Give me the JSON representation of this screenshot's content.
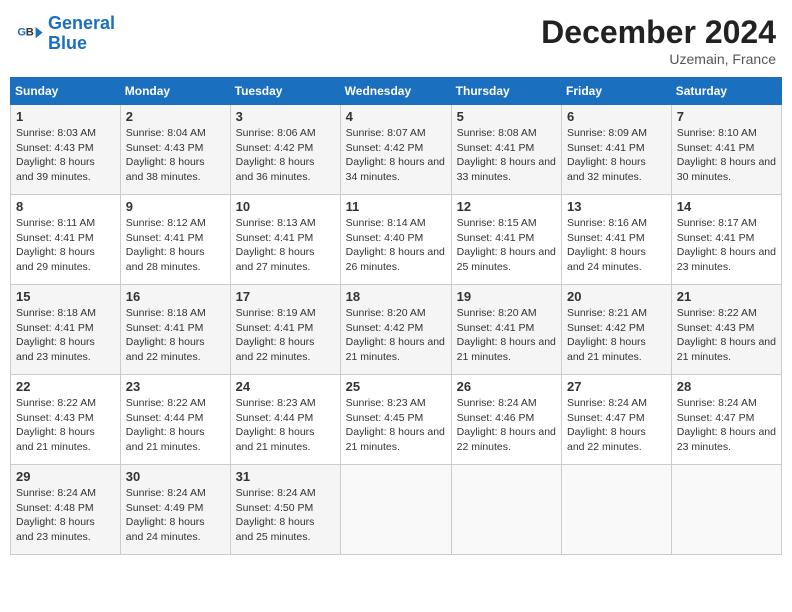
{
  "header": {
    "logo_line1": "General",
    "logo_line2": "Blue",
    "month_title": "December 2024",
    "location": "Uzemain, France"
  },
  "weekdays": [
    "Sunday",
    "Monday",
    "Tuesday",
    "Wednesday",
    "Thursday",
    "Friday",
    "Saturday"
  ],
  "weeks": [
    [
      {
        "day": "1",
        "sunrise": "Sunrise: 8:03 AM",
        "sunset": "Sunset: 4:43 PM",
        "daylight": "Daylight: 8 hours and 39 minutes."
      },
      {
        "day": "2",
        "sunrise": "Sunrise: 8:04 AM",
        "sunset": "Sunset: 4:43 PM",
        "daylight": "Daylight: 8 hours and 38 minutes."
      },
      {
        "day": "3",
        "sunrise": "Sunrise: 8:06 AM",
        "sunset": "Sunset: 4:42 PM",
        "daylight": "Daylight: 8 hours and 36 minutes."
      },
      {
        "day": "4",
        "sunrise": "Sunrise: 8:07 AM",
        "sunset": "Sunset: 4:42 PM",
        "daylight": "Daylight: 8 hours and 34 minutes."
      },
      {
        "day": "5",
        "sunrise": "Sunrise: 8:08 AM",
        "sunset": "Sunset: 4:41 PM",
        "daylight": "Daylight: 8 hours and 33 minutes."
      },
      {
        "day": "6",
        "sunrise": "Sunrise: 8:09 AM",
        "sunset": "Sunset: 4:41 PM",
        "daylight": "Daylight: 8 hours and 32 minutes."
      },
      {
        "day": "7",
        "sunrise": "Sunrise: 8:10 AM",
        "sunset": "Sunset: 4:41 PM",
        "daylight": "Daylight: 8 hours and 30 minutes."
      }
    ],
    [
      {
        "day": "8",
        "sunrise": "Sunrise: 8:11 AM",
        "sunset": "Sunset: 4:41 PM",
        "daylight": "Daylight: 8 hours and 29 minutes."
      },
      {
        "day": "9",
        "sunrise": "Sunrise: 8:12 AM",
        "sunset": "Sunset: 4:41 PM",
        "daylight": "Daylight: 8 hours and 28 minutes."
      },
      {
        "day": "10",
        "sunrise": "Sunrise: 8:13 AM",
        "sunset": "Sunset: 4:41 PM",
        "daylight": "Daylight: 8 hours and 27 minutes."
      },
      {
        "day": "11",
        "sunrise": "Sunrise: 8:14 AM",
        "sunset": "Sunset: 4:40 PM",
        "daylight": "Daylight: 8 hours and 26 minutes."
      },
      {
        "day": "12",
        "sunrise": "Sunrise: 8:15 AM",
        "sunset": "Sunset: 4:41 PM",
        "daylight": "Daylight: 8 hours and 25 minutes."
      },
      {
        "day": "13",
        "sunrise": "Sunrise: 8:16 AM",
        "sunset": "Sunset: 4:41 PM",
        "daylight": "Daylight: 8 hours and 24 minutes."
      },
      {
        "day": "14",
        "sunrise": "Sunrise: 8:17 AM",
        "sunset": "Sunset: 4:41 PM",
        "daylight": "Daylight: 8 hours and 23 minutes."
      }
    ],
    [
      {
        "day": "15",
        "sunrise": "Sunrise: 8:18 AM",
        "sunset": "Sunset: 4:41 PM",
        "daylight": "Daylight: 8 hours and 23 minutes."
      },
      {
        "day": "16",
        "sunrise": "Sunrise: 8:18 AM",
        "sunset": "Sunset: 4:41 PM",
        "daylight": "Daylight: 8 hours and 22 minutes."
      },
      {
        "day": "17",
        "sunrise": "Sunrise: 8:19 AM",
        "sunset": "Sunset: 4:41 PM",
        "daylight": "Daylight: 8 hours and 22 minutes."
      },
      {
        "day": "18",
        "sunrise": "Sunrise: 8:20 AM",
        "sunset": "Sunset: 4:42 PM",
        "daylight": "Daylight: 8 hours and 21 minutes."
      },
      {
        "day": "19",
        "sunrise": "Sunrise: 8:20 AM",
        "sunset": "Sunset: 4:41 PM",
        "daylight": "Daylight: 8 hours and 21 minutes."
      },
      {
        "day": "20",
        "sunrise": "Sunrise: 8:21 AM",
        "sunset": "Sunset: 4:42 PM",
        "daylight": "Daylight: 8 hours and 21 minutes."
      },
      {
        "day": "21",
        "sunrise": "Sunrise: 8:22 AM",
        "sunset": "Sunset: 4:43 PM",
        "daylight": "Daylight: 8 hours and 21 minutes."
      }
    ],
    [
      {
        "day": "22",
        "sunrise": "Sunrise: 8:22 AM",
        "sunset": "Sunset: 4:43 PM",
        "daylight": "Daylight: 8 hours and 21 minutes."
      },
      {
        "day": "23",
        "sunrise": "Sunrise: 8:22 AM",
        "sunset": "Sunset: 4:44 PM",
        "daylight": "Daylight: 8 hours and 21 minutes."
      },
      {
        "day": "24",
        "sunrise": "Sunrise: 8:23 AM",
        "sunset": "Sunset: 4:44 PM",
        "daylight": "Daylight: 8 hours and 21 minutes."
      },
      {
        "day": "25",
        "sunrise": "Sunrise: 8:23 AM",
        "sunset": "Sunset: 4:45 PM",
        "daylight": "Daylight: 8 hours and 21 minutes."
      },
      {
        "day": "26",
        "sunrise": "Sunrise: 8:24 AM",
        "sunset": "Sunset: 4:46 PM",
        "daylight": "Daylight: 8 hours and 22 minutes."
      },
      {
        "day": "27",
        "sunrise": "Sunrise: 8:24 AM",
        "sunset": "Sunset: 4:47 PM",
        "daylight": "Daylight: 8 hours and 22 minutes."
      },
      {
        "day": "28",
        "sunrise": "Sunrise: 8:24 AM",
        "sunset": "Sunset: 4:47 PM",
        "daylight": "Daylight: 8 hours and 23 minutes."
      }
    ],
    [
      {
        "day": "29",
        "sunrise": "Sunrise: 8:24 AM",
        "sunset": "Sunset: 4:48 PM",
        "daylight": "Daylight: 8 hours and 23 minutes."
      },
      {
        "day": "30",
        "sunrise": "Sunrise: 8:24 AM",
        "sunset": "Sunset: 4:49 PM",
        "daylight": "Daylight: 8 hours and 24 minutes."
      },
      {
        "day": "31",
        "sunrise": "Sunrise: 8:24 AM",
        "sunset": "Sunset: 4:50 PM",
        "daylight": "Daylight: 8 hours and 25 minutes."
      },
      null,
      null,
      null,
      null
    ]
  ]
}
